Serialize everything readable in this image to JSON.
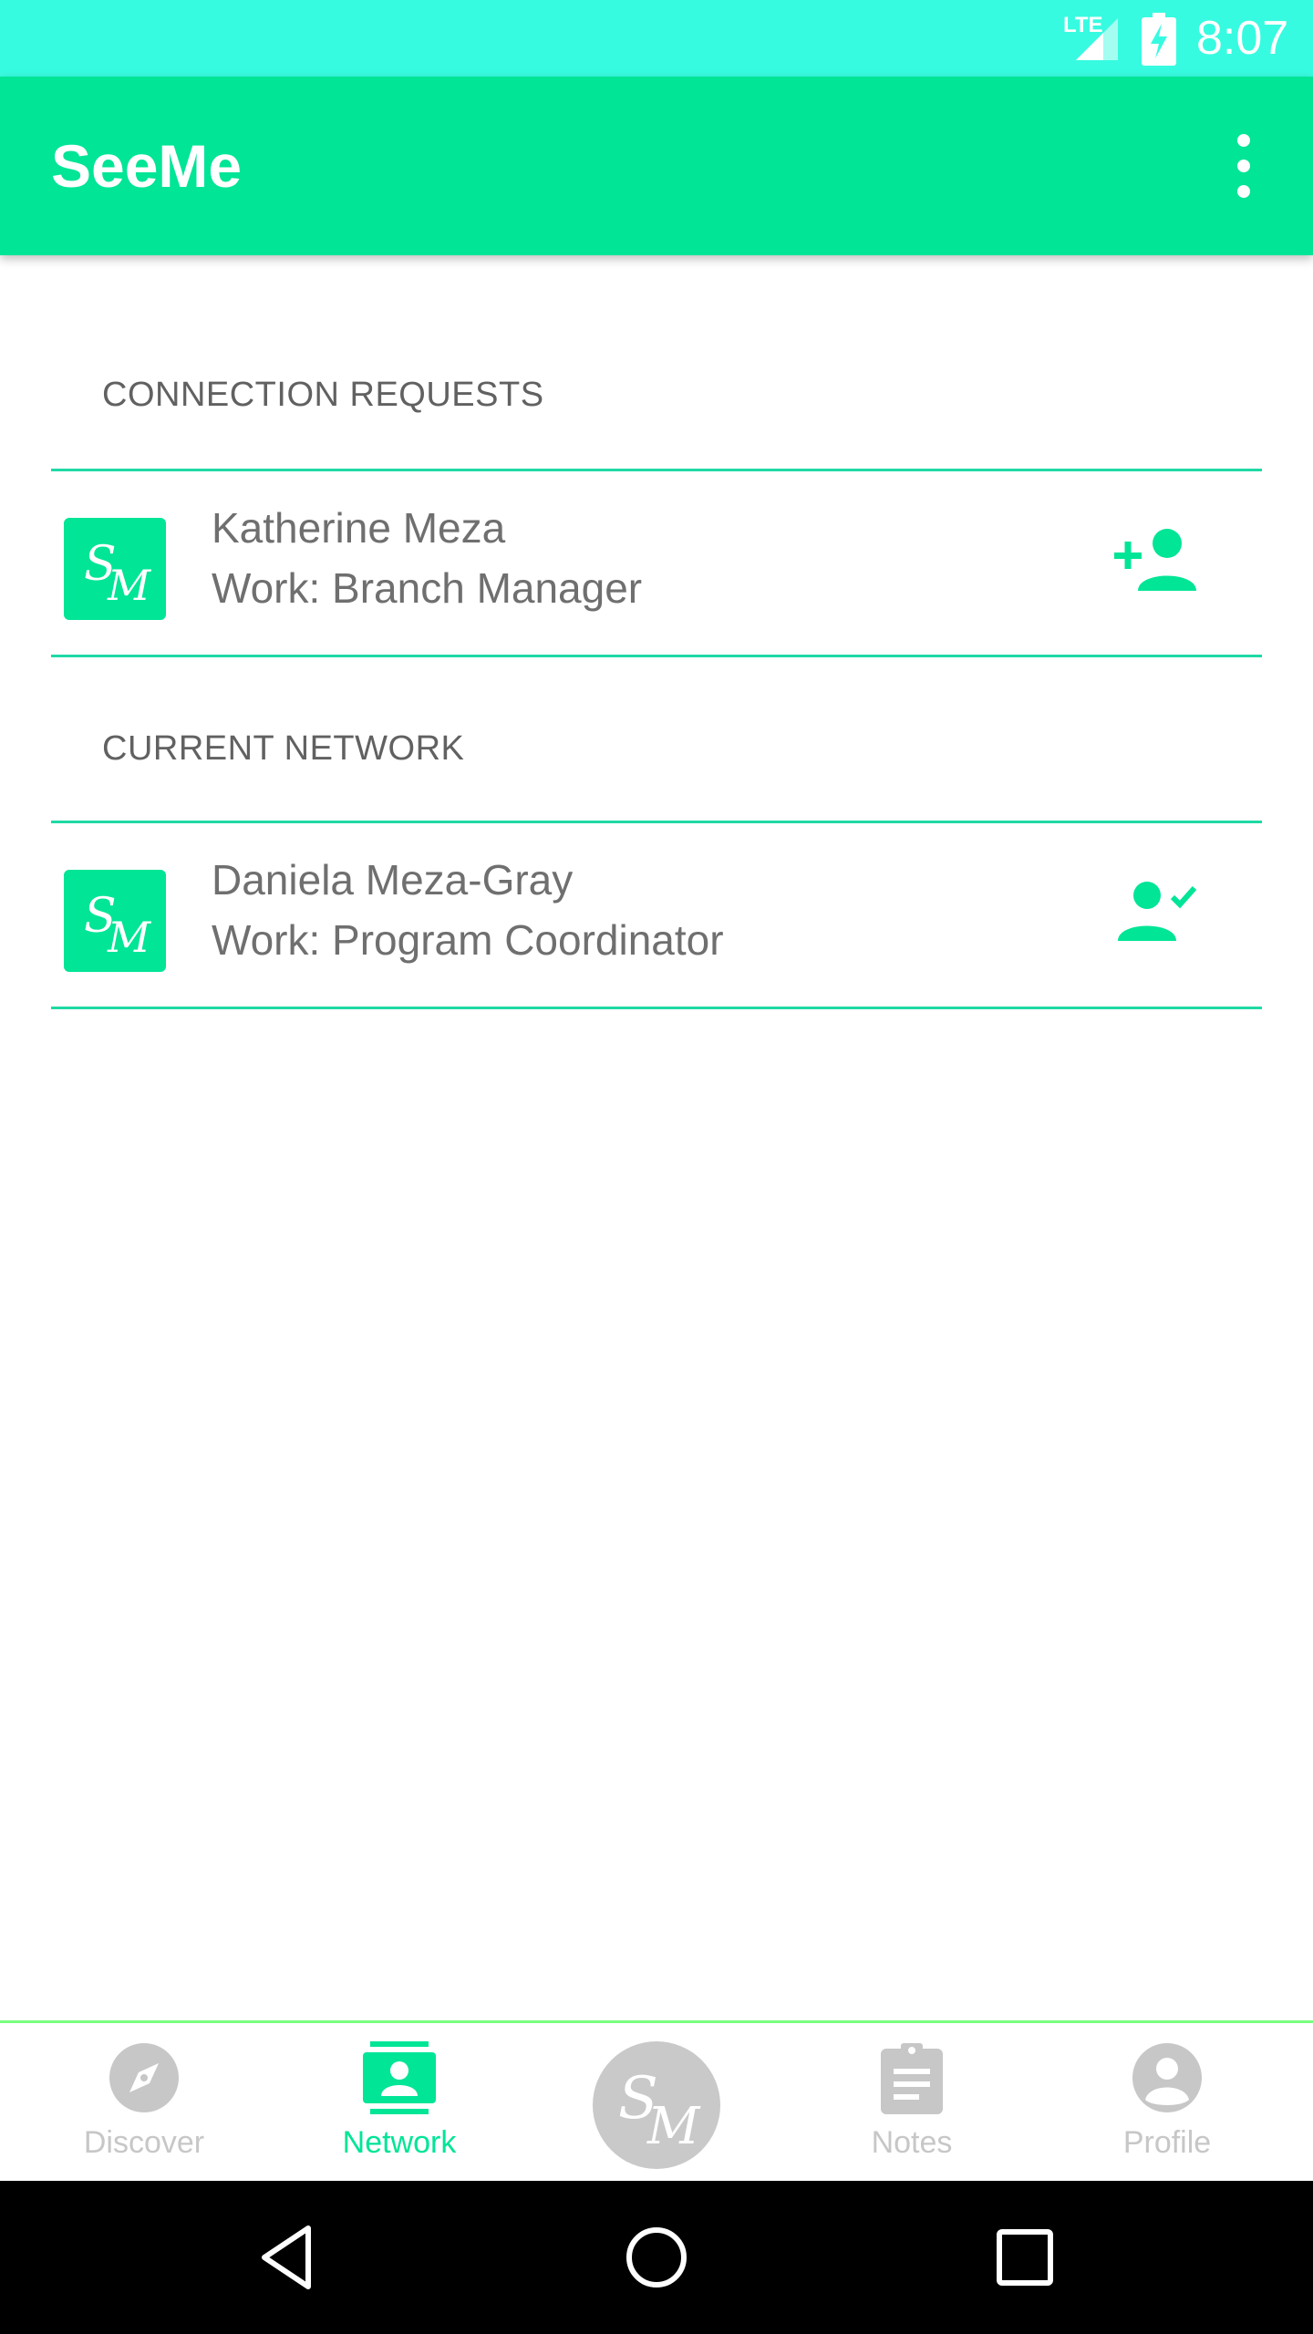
{
  "status_bar": {
    "network": "LTE",
    "time": "8:07"
  },
  "app_bar": {
    "title": "SeeMe",
    "menu_icon": "more-vert-icon"
  },
  "sections": {
    "connection_requests": {
      "header": "CONNECTION REQUESTS",
      "items": [
        {
          "name": "Katherine Meza",
          "work": "Work: Branch Manager",
          "avatar": "SM",
          "action_icon": "person-add-icon"
        }
      ]
    },
    "current_network": {
      "header": "CURRENT NETWORK",
      "items": [
        {
          "name": "Daniela Meza-Gray",
          "work": "Work: Program Coordinator",
          "avatar": "SM",
          "action_icon": "person-check-icon"
        }
      ]
    }
  },
  "bottom_nav": {
    "items": [
      {
        "label": "Discover",
        "icon": "compass-icon",
        "active": false
      },
      {
        "label": "Network",
        "icon": "contacts-icon",
        "active": true
      },
      {
        "label": "",
        "icon": "seeme-logo-icon",
        "active": false
      },
      {
        "label": "Notes",
        "icon": "clipboard-icon",
        "active": false
      },
      {
        "label": "Profile",
        "icon": "account-circle-icon",
        "active": false
      }
    ]
  },
  "colors": {
    "status_bar": "#37FBE0",
    "primary": "#00E596",
    "divider": "#1FD9A5",
    "nav_inactive": "#C7C7C7",
    "nav_border": "#79FF7F"
  }
}
